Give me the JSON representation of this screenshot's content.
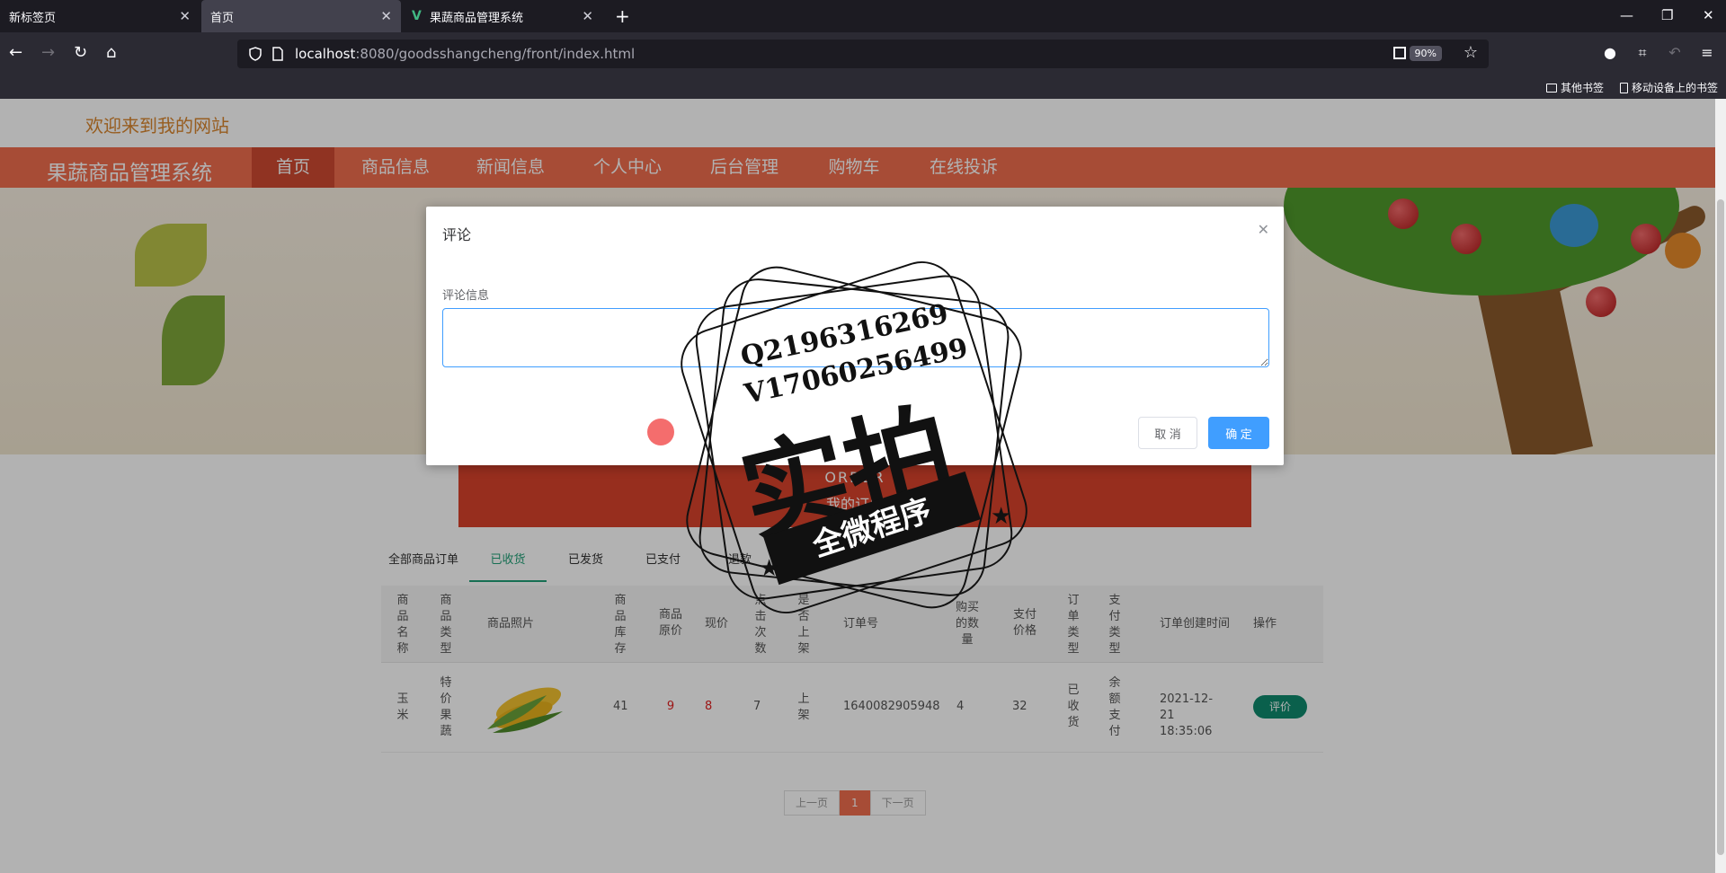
{
  "browser": {
    "tabs": [
      {
        "label": "新标签页"
      },
      {
        "label": "首页"
      },
      {
        "label": "果蔬商品管理系统"
      }
    ],
    "url_host": "localhost",
    "url_path": ":8080/goodsshangcheng/front/index.html",
    "zoom": "90%",
    "bookmarks": [
      "其他书签",
      "移动设备上的书签"
    ]
  },
  "site": {
    "welcome": "欢迎来到我的网站",
    "title": "果蔬商品管理系统",
    "nav": [
      "首页",
      "商品信息",
      "新闻信息",
      "个人中心",
      "后台管理",
      "购物车",
      "在线投诉"
    ]
  },
  "orders": {
    "banner_en": "ORDER",
    "banner_cn": "我的订单",
    "tabs": [
      "全部商品订单",
      "已收货",
      "已发货",
      "已支付",
      "退款"
    ],
    "headers": [
      "商品名称",
      "商品类型",
      "商品照片",
      "商品库存",
      "商品原价",
      "现价",
      "点击次数",
      "是否上架",
      "订单号",
      "购买的数量",
      "支付价格",
      "订单类型",
      "支付类型",
      "订单创建时间",
      "操作"
    ],
    "row": {
      "name": "玉米",
      "type": "特价果蔬",
      "stock": "41",
      "orig_price": "9",
      "price": "8",
      "clicks": "7",
      "onsale": "上架",
      "order_no": "1640082905948",
      "qty": "4",
      "paid": "32",
      "order_type": "已收货",
      "pay_type": "余额支付",
      "created": "2021-12-21 18:35:06",
      "action": "评价"
    },
    "pager": {
      "prev": "上一页",
      "current": "1",
      "next": "下一页"
    }
  },
  "modal": {
    "title": "评论",
    "label": "评论信息",
    "value": "",
    "cancel": "取 消",
    "ok": "确 定"
  },
  "watermark": {
    "line1": "Q2196316269",
    "line2": "V17060256499",
    "big": "实拍",
    "ribbon": "全微程序"
  },
  "colors": {
    "nav": "#ef6d4e",
    "nav_active": "#cf4a32",
    "accent_green": "#21a077",
    "primary_blue": "#409eff"
  }
}
